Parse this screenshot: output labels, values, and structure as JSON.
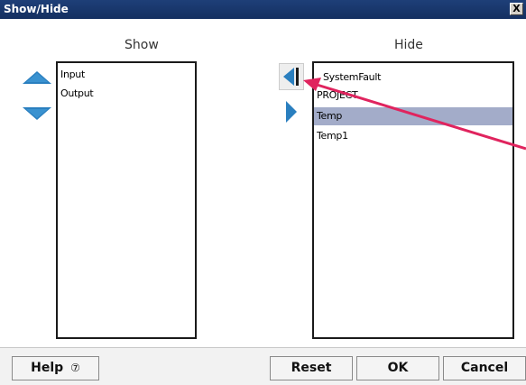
{
  "window": {
    "title": "Show/Hide",
    "close_glyph": "X"
  },
  "show": {
    "header": "Show",
    "items": [
      "Input",
      "Output"
    ]
  },
  "hide": {
    "header": "Hide",
    "items": [
      "SystemFault",
      "PROJECT",
      "Temp",
      "Temp1"
    ],
    "selected": "Temp"
  },
  "icons": {
    "up": "arrow-up-icon",
    "down": "arrow-down-icon",
    "move_left": "arrow-left-icon",
    "move_right": "arrow-right-icon",
    "help": "help-circle-icon"
  },
  "buttons": {
    "help": "Help",
    "help_glyph": "⑦",
    "reset": "Reset",
    "ok": "OK",
    "cancel": "Cancel"
  },
  "colors": {
    "titlebar": "#1e3f78",
    "selection": "#a3acc9",
    "arrow_blue": "#2a7fbf",
    "annotation": "#e0245e"
  }
}
